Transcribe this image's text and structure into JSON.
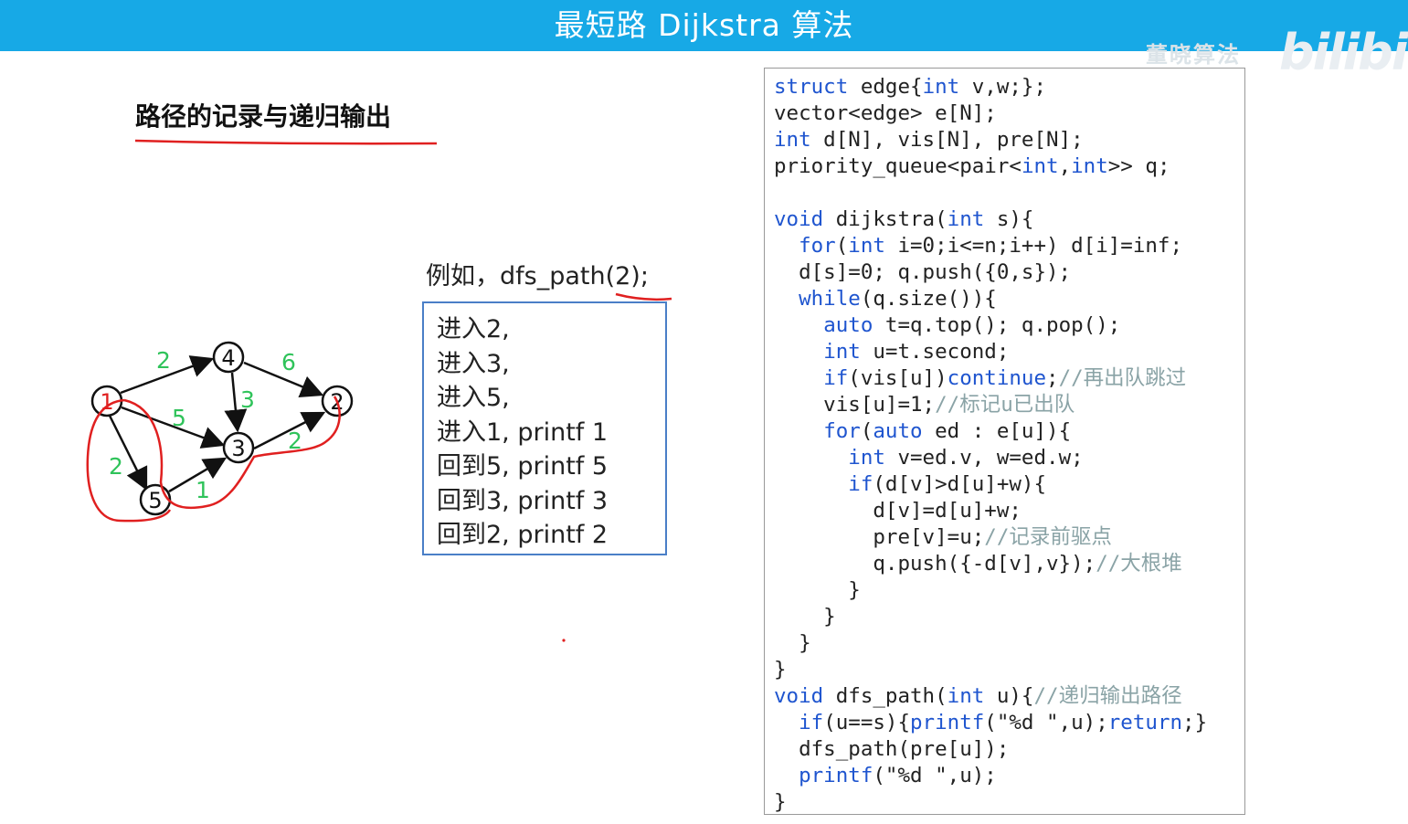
{
  "header": {
    "title": "最短路 Dijkstra 算法"
  },
  "watermark": {
    "text": "董晓算法",
    "logo": "bilibili"
  },
  "section": {
    "title": "路径的记录与递归输出"
  },
  "example": {
    "label": "例如，dfs_path(2);",
    "steps": [
      "进入2,",
      "进入3,",
      "进入5,",
      "进入1,  printf 1",
      "回到5,  printf 5",
      "回到3,  printf 3",
      "回到2,  printf 2"
    ]
  },
  "graph": {
    "nodes": [
      "1",
      "4",
      "2",
      "3",
      "5"
    ],
    "edge_weights": [
      "2",
      "6",
      "3",
      "5",
      "2",
      "2",
      "1"
    ]
  },
  "code": {
    "lines": [
      [
        [
          "k",
          "struct"
        ],
        [
          "t",
          " edge{"
        ],
        [
          "k",
          "int"
        ],
        [
          "t",
          " v,w;};"
        ]
      ],
      [
        [
          "t",
          "vector<edge> e[N];"
        ]
      ],
      [
        [
          "k",
          "int"
        ],
        [
          "t",
          " d[N], vis[N], pre[N];"
        ]
      ],
      [
        [
          "t",
          "priority_queue<pair<"
        ],
        [
          "k",
          "int"
        ],
        [
          "t",
          ","
        ],
        [
          "k",
          "int"
        ],
        [
          "t",
          ">> q;"
        ]
      ],
      [
        [
          "t",
          ""
        ]
      ],
      [
        [
          "k",
          "void"
        ],
        [
          "t",
          " dijkstra("
        ],
        [
          "k",
          "int"
        ],
        [
          "t",
          " s){"
        ]
      ],
      [
        [
          "t",
          "  "
        ],
        [
          "k",
          "for"
        ],
        [
          "t",
          "("
        ],
        [
          "k",
          "int"
        ],
        [
          "t",
          " i=0;i<=n;i++) d[i]=inf;"
        ]
      ],
      [
        [
          "t",
          "  d[s]=0; q.push({0,s});"
        ]
      ],
      [
        [
          "t",
          "  "
        ],
        [
          "k",
          "while"
        ],
        [
          "t",
          "(q.size()){"
        ]
      ],
      [
        [
          "t",
          "    "
        ],
        [
          "k",
          "auto"
        ],
        [
          "t",
          " t=q.top(); q.pop();"
        ]
      ],
      [
        [
          "t",
          "    "
        ],
        [
          "k",
          "int"
        ],
        [
          "t",
          " u=t.second;"
        ]
      ],
      [
        [
          "t",
          "    "
        ],
        [
          "k",
          "if"
        ],
        [
          "t",
          "(vis[u])"
        ],
        [
          "k",
          "continue"
        ],
        [
          "t",
          ";"
        ],
        [
          "c",
          "//再出队跳过"
        ]
      ],
      [
        [
          "t",
          "    vis[u]=1;"
        ],
        [
          "c",
          "//标记u已出队"
        ]
      ],
      [
        [
          "t",
          "    "
        ],
        [
          "k",
          "for"
        ],
        [
          "t",
          "("
        ],
        [
          "k",
          "auto"
        ],
        [
          "t",
          " ed : e[u]){"
        ]
      ],
      [
        [
          "t",
          "      "
        ],
        [
          "k",
          "int"
        ],
        [
          "t",
          " v=ed.v, w=ed.w;"
        ]
      ],
      [
        [
          "t",
          "      "
        ],
        [
          "k",
          "if"
        ],
        [
          "t",
          "(d[v]>d[u]+w){"
        ]
      ],
      [
        [
          "t",
          "        d[v]=d[u]+w;"
        ]
      ],
      [
        [
          "t",
          "        pre[v]=u;"
        ],
        [
          "c",
          "//记录前驱点"
        ]
      ],
      [
        [
          "t",
          "        q.push({-d[v],v});"
        ],
        [
          "c",
          "//大根堆"
        ]
      ],
      [
        [
          "t",
          "      }"
        ]
      ],
      [
        [
          "t",
          "    }"
        ]
      ],
      [
        [
          "t",
          "  }"
        ]
      ],
      [
        [
          "t",
          "}"
        ]
      ],
      [
        [
          "k",
          "void"
        ],
        [
          "t",
          " dfs_path("
        ],
        [
          "k",
          "int"
        ],
        [
          "t",
          " u){"
        ],
        [
          "c",
          "//递归输出路径"
        ]
      ],
      [
        [
          "t",
          "  "
        ],
        [
          "k",
          "if"
        ],
        [
          "t",
          "(u==s){"
        ],
        [
          "k",
          "printf"
        ],
        [
          "t",
          "(\"%d \",u);"
        ],
        [
          "k",
          "return"
        ],
        [
          "t",
          ";}"
        ]
      ],
      [
        [
          "t",
          "  dfs_path(pre[u]);"
        ]
      ],
      [
        [
          "t",
          "  "
        ],
        [
          "k",
          "printf"
        ],
        [
          "t",
          "(\"%d \",u);"
        ]
      ],
      [
        [
          "t",
          "}"
        ]
      ]
    ]
  },
  "colors": {
    "header": "#17a9e6",
    "keyword": "#1f55cf",
    "comment": "#8aa3a6",
    "weight": "#2fc35a",
    "annotation": "#e02020",
    "box_border": "#4a7fc7"
  }
}
